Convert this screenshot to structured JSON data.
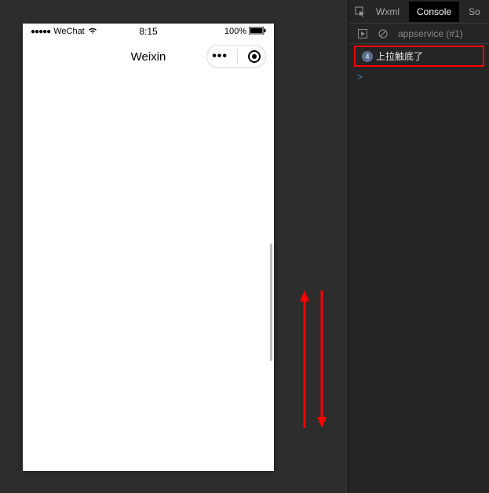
{
  "simulator": {
    "status": {
      "carrier": "WeChat",
      "signal_dots": "●●●●●",
      "time": "8:15",
      "battery_pct": "100%"
    },
    "nav": {
      "title": "Weixin"
    }
  },
  "devtools": {
    "tabs": {
      "wxml": "Wxml",
      "console": "Console",
      "sources": "So"
    },
    "toolbar": {
      "context": "appservice",
      "context_count": "(#1)"
    },
    "console": {
      "log_count": "4",
      "log_message": "上拉触底了",
      "prompt": ">"
    }
  }
}
